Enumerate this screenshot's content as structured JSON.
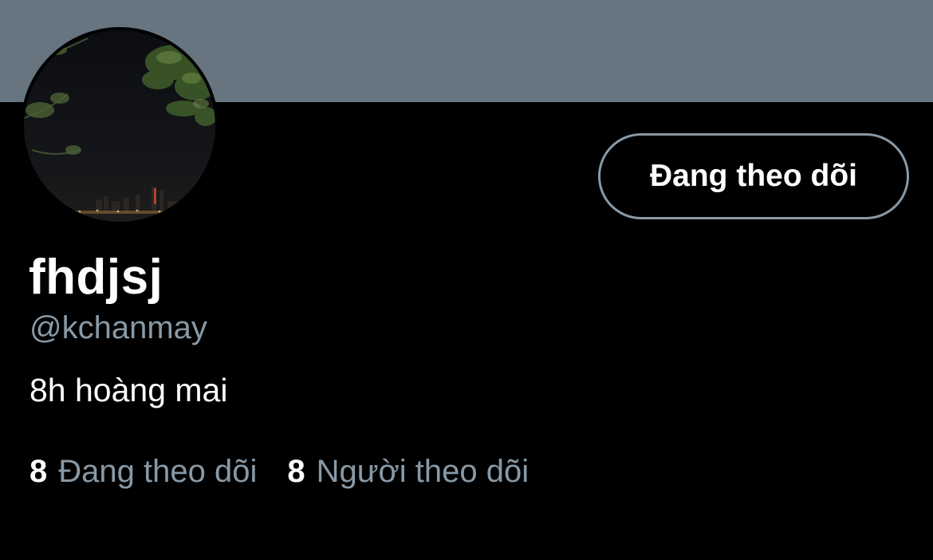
{
  "profile": {
    "display_name": "fhdjsj",
    "handle": "@kchanmay",
    "bio": "8h hoàng mai",
    "follow_button_label": "Đang theo dõi"
  },
  "stats": {
    "following_count": "8",
    "following_label": "Đang theo dõi",
    "followers_count": "8",
    "followers_label": "Người theo dõi"
  },
  "colors": {
    "banner": "#66757f",
    "background": "#000000",
    "secondary_text": "#8899a6",
    "primary_text": "#ffffff"
  }
}
